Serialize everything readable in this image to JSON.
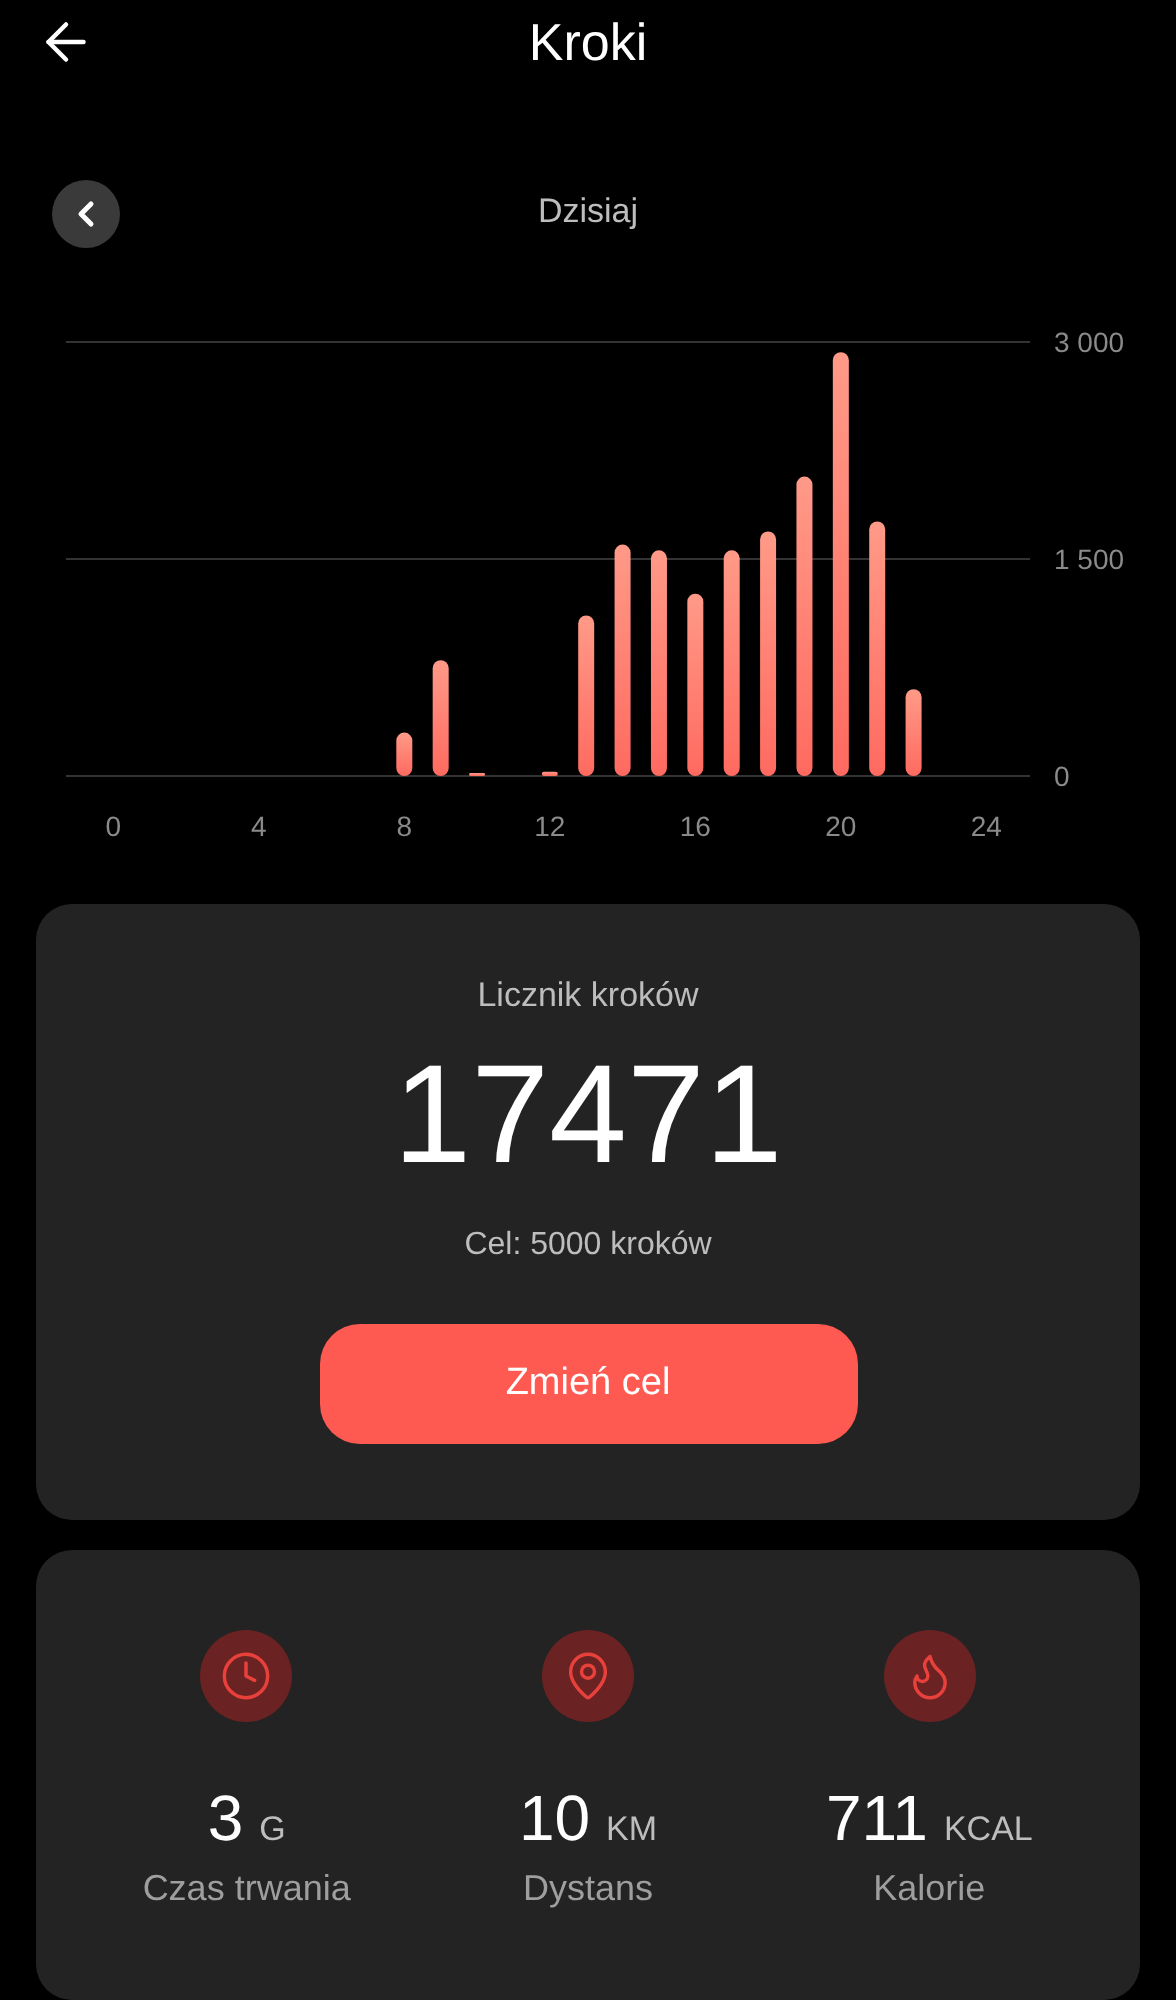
{
  "header": {
    "title": "Kroki"
  },
  "period": {
    "label": "Dzisiaj"
  },
  "chart_data": {
    "type": "bar",
    "x": [
      8,
      9,
      10,
      12,
      13,
      14,
      15,
      16,
      17,
      18,
      19,
      20,
      21,
      22
    ],
    "series": [
      {
        "color": "#ff6a60",
        "values": [
          300,
          800,
          20,
          30,
          1110,
          1600,
          1560,
          1260,
          1560,
          1690,
          2070,
          2930,
          1760,
          600
        ]
      }
    ],
    "xlim": [
      -1.3,
      25.2
    ],
    "ylim": [
      0,
      3000
    ],
    "xticks": [
      0,
      4,
      8,
      12,
      16,
      20,
      24
    ],
    "yticks": [
      {
        "value": 0,
        "label": "0"
      },
      {
        "value": 1500,
        "label": "1 500"
      },
      {
        "value": 3000,
        "label": "3 000"
      }
    ]
  },
  "summary": {
    "title": "Licznik kroków",
    "value": "17471",
    "goal": "Cel: 5000 kroków",
    "button": "Zmień cel"
  },
  "stats": [
    {
      "kind": "duration",
      "value": "3",
      "unit": "G",
      "label": "Czas trwania"
    },
    {
      "kind": "distance",
      "value": "10",
      "unit": "KM",
      "label": "Dystans"
    },
    {
      "kind": "calories",
      "value": "711",
      "unit": "KCAL",
      "label": "Kalorie"
    }
  ]
}
